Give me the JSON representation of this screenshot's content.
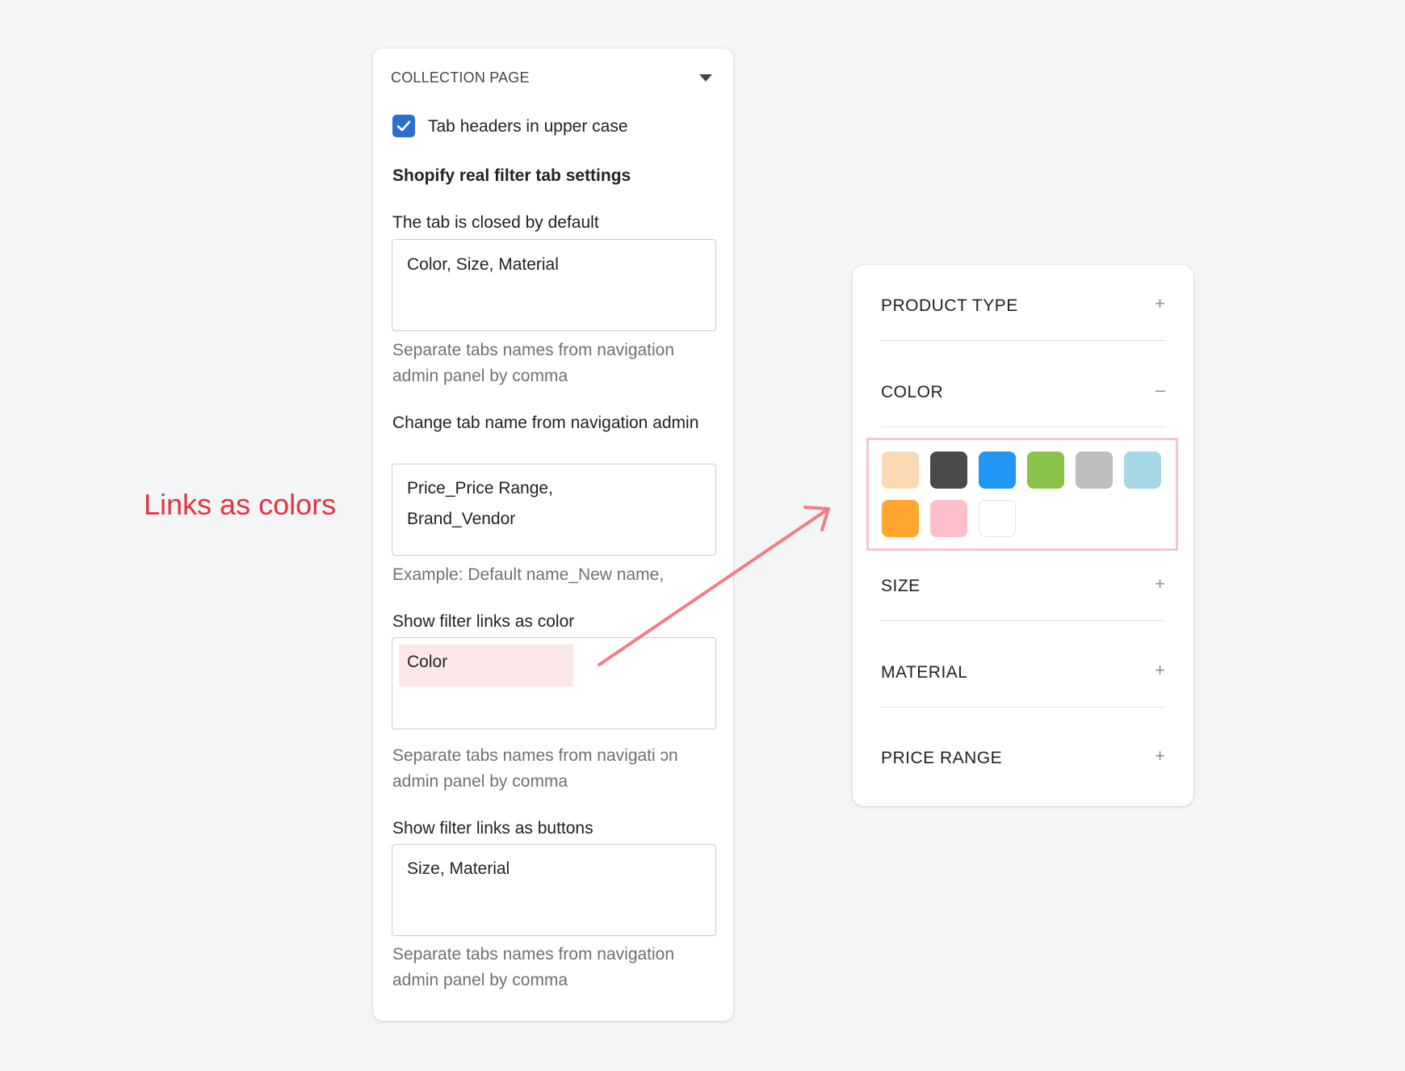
{
  "annotation": {
    "text": "Links as colors",
    "color": "#e2343f"
  },
  "settings": {
    "section_title": "COLLECTION PAGE",
    "checkbox": {
      "label": "Tab headers in upper case",
      "checked": true,
      "color": "#2c6ecb"
    },
    "subheading": "Shopify real filter tab settings",
    "fields": [
      {
        "label": "The tab is closed by default",
        "value": "Color, Size, Material",
        "help": "Separate tabs names from navigation admin panel by comma"
      },
      {
        "label": "Change tab name from navigation admin",
        "value": "Price_Price Range,\nBrand_Vendor",
        "help": "Example: Default name_New name,"
      },
      {
        "label": "Show filter links as color",
        "value": "Color",
        "help": "Separate tabs names from navigati ɔn admin panel by comma"
      },
      {
        "label": "Show filter links as buttons",
        "value": "Size, Material",
        "help": "Separate tabs names from navigation admin panel by comma"
      }
    ]
  },
  "filters": {
    "items": [
      {
        "name": "PRODUCT TYPE",
        "sign": "+"
      },
      {
        "name": "COLOR",
        "sign": "–"
      },
      {
        "name": "SIZE",
        "sign": "+"
      },
      {
        "name": "MATERIAL",
        "sign": "+"
      },
      {
        "name": "PRICE RANGE",
        "sign": "+"
      }
    ],
    "swatches": [
      "#fad9b3",
      "#4a4a4a",
      "#2196f3",
      "#8bc34a",
      "#bdbdbd",
      "#a8d8e6",
      "#ffa530",
      "#ffbfcb",
      "#ffffff"
    ],
    "highlight_color": "#f5c6c9",
    "arrow_color": "#ef7f85"
  }
}
